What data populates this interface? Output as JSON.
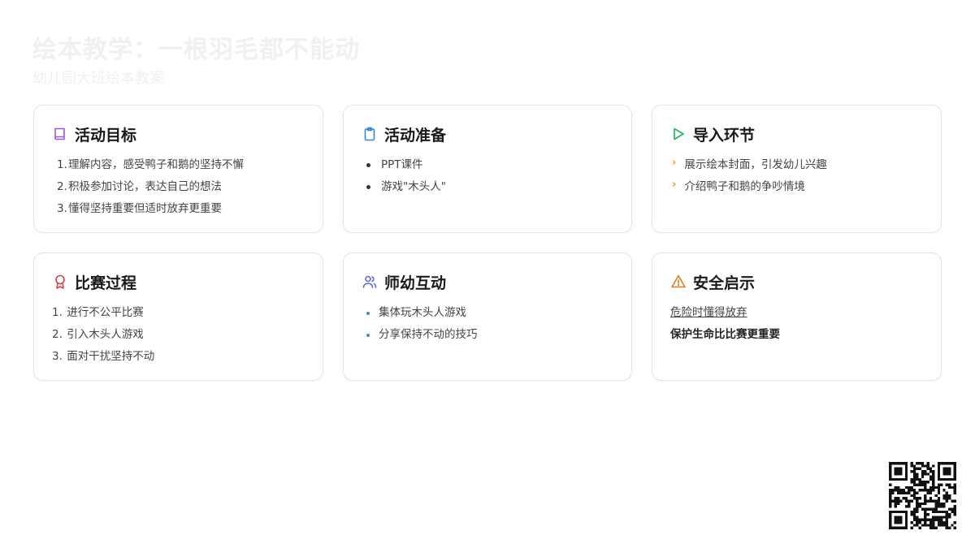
{
  "header": {
    "title": "绘本教学：一根羽毛都不能动",
    "subtitle": "幼儿园大班绘本教案"
  },
  "cards": {
    "goals": {
      "title": "活动目标",
      "icon": "book-icon",
      "items": [
        "理解内容，感受鸭子和鹅的坚持不懈",
        "积极参加讨论，表达自己的想法",
        "懂得坚持重要但适时放弃更重要"
      ]
    },
    "prep": {
      "title": "活动准备",
      "icon": "clipboard-icon",
      "items": [
        "PPT课件",
        "游戏\"木头人\""
      ]
    },
    "intro": {
      "title": "导入环节",
      "icon": "play-icon",
      "items": [
        "展示绘本封面，引发幼儿兴趣",
        "介绍鸭子和鹅的争吵情境"
      ]
    },
    "process": {
      "title": "比赛过程",
      "icon": "award-icon",
      "items": [
        "进行不公平比赛",
        "引入木头人游戏",
        "面对干扰坚持不动"
      ]
    },
    "interact": {
      "title": "师幼互动",
      "icon": "users-icon",
      "items": [
        "集体玩木头人游戏",
        "分享保持不动的技巧"
      ]
    },
    "safety": {
      "title": "安全启示",
      "icon": "warning-icon",
      "line1": "危险时懂得放弃",
      "line2": "保护生命比比赛更重要"
    }
  },
  "colors": {
    "goals": "#9b59d0",
    "prep": "#3b82d6",
    "intro": "#22b35b",
    "process": "#d64545",
    "interact": "#5b6bd6",
    "safety": "#e07a1f"
  }
}
